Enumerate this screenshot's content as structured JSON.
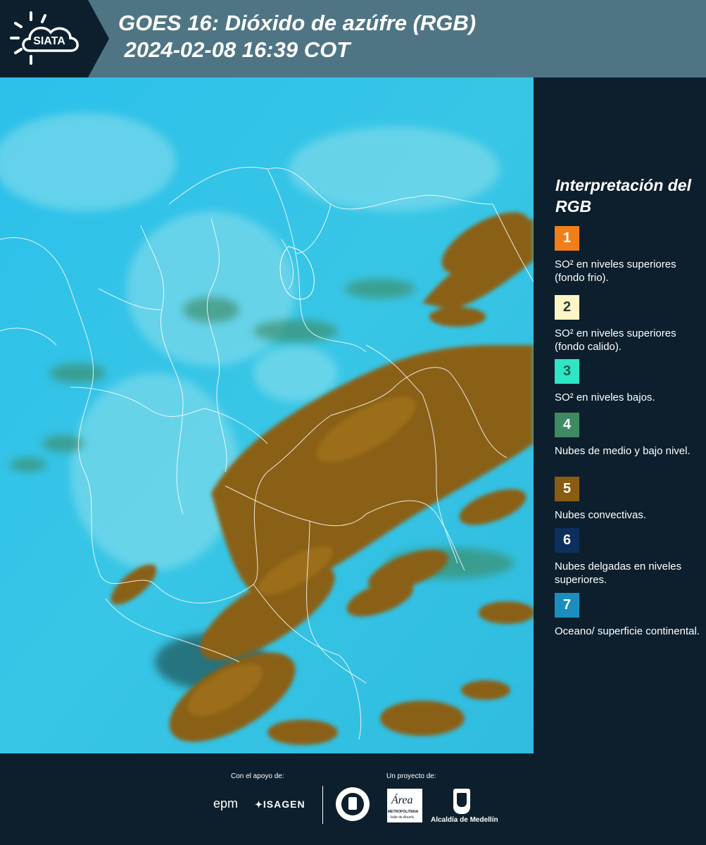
{
  "header": {
    "logo_text": "SIATA",
    "title_line1": "GOES 16: Dióxido de azúfre (RGB)",
    "title_line2": " 2024-02-08 16:39 COT"
  },
  "legend": {
    "title": "Interpretación del RGB",
    "items": [
      {
        "number": "1",
        "color": "#f07f1a",
        "label": "SO² en niveles superiores (fondo frio)."
      },
      {
        "number": "2",
        "color": "#fdf6c4",
        "label": "SO² en niveles superiores (fondo calido)."
      },
      {
        "number": "3",
        "color": "#2ee6c4",
        "label": "SO² en niveles bajos."
      },
      {
        "number": "4",
        "color": "#3d8a63",
        "label": "Nubes de medio y bajo nivel."
      },
      {
        "number": "5",
        "color": "#8a5c12",
        "label": "Nubes convectivas."
      },
      {
        "number": "6",
        "color": "#0d2f5e",
        "label": "Nubes delgadas en niveles superiores."
      },
      {
        "number": "7",
        "color": "#1a8fbf",
        "label": "Oceano/ superficie continental."
      }
    ]
  },
  "footer": {
    "support_label": "Con el apoyo de:",
    "project_label": "Un proyecto de:",
    "epm": "epm",
    "isagen": "ISAGEN",
    "metropolitana": "METROPOLITANA",
    "area": "Área",
    "valle": "Valle de Aburrá",
    "alcaldia": "Alcaldía de Medellín"
  },
  "colors": {
    "header_bg": "#4f7584",
    "dark_bg": "#0d1f2d",
    "ocean": "#32c1e6",
    "cloud": "#8a5c12"
  }
}
